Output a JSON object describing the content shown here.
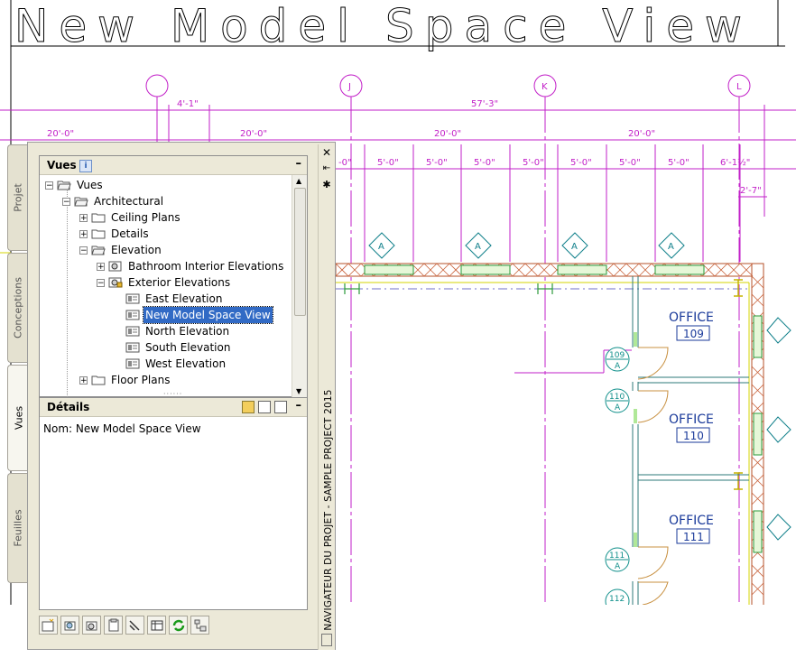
{
  "drawing": {
    "title": "New Model Space View",
    "grid_bubbles": [
      "J",
      "K",
      "L"
    ],
    "dimensions": {
      "row1": [
        "4'-1\"",
        "57'-3\""
      ],
      "row2": [
        "20'-0\"",
        "20'-0\"",
        "20'-0\"",
        "20'-0\""
      ],
      "row3": [
        "-0\"",
        "5'-0\"",
        "5'-0\"",
        "5'-0\"",
        "5'-0\"",
        "5'-0\"",
        "5'-0\"",
        "5'-0\"",
        "6'-1½\""
      ],
      "right": "2'-7\""
    },
    "window_tag": "A",
    "rooms": [
      {
        "name": "OFFICE",
        "number": "109"
      },
      {
        "name": "OFFICE",
        "number": "110"
      },
      {
        "name": "OFFICE",
        "number": "111"
      }
    ],
    "door_tags": [
      {
        "number": "109",
        "type": "A"
      },
      {
        "number": "110",
        "type": "A"
      },
      {
        "number": "111",
        "type": "A"
      },
      {
        "number": "112",
        "type": ""
      }
    ]
  },
  "navigator": {
    "side_tabs": [
      "Projet",
      "Conceptions",
      "Vues",
      "Feuilles"
    ],
    "active_tab": "Vues",
    "title": "NAVIGATEUR DU PROJET - SAMPLE PROJECT 2015",
    "views_section": {
      "title": "Vues",
      "tree": [
        {
          "label": "Vues",
          "level": 0,
          "icon": "folder-open",
          "expander": "-"
        },
        {
          "label": "Architectural",
          "level": 1,
          "icon": "folder-open",
          "expander": "-"
        },
        {
          "label": "Ceiling Plans",
          "level": 2,
          "icon": "folder",
          "expander": "+"
        },
        {
          "label": "Details",
          "level": 2,
          "icon": "folder",
          "expander": "+"
        },
        {
          "label": "Elevation",
          "level": 2,
          "icon": "folder-open",
          "expander": "-"
        },
        {
          "label": "Bathroom Interior Elevations",
          "level": 3,
          "icon": "view-set",
          "expander": "+"
        },
        {
          "label": "Exterior Elevations",
          "level": 3,
          "icon": "view-set-locked",
          "expander": "-"
        },
        {
          "label": "East Elevation",
          "level": 4,
          "icon": "view"
        },
        {
          "label": "New Model Space View",
          "level": 4,
          "icon": "view",
          "selected": true
        },
        {
          "label": "North Elevation",
          "level": 4,
          "icon": "view"
        },
        {
          "label": "South Elevation",
          "level": 4,
          "icon": "view"
        },
        {
          "label": "West Elevation",
          "level": 4,
          "icon": "view"
        },
        {
          "label": "Floor Plans",
          "level": 2,
          "icon": "folder",
          "expander": "+"
        }
      ]
    },
    "details_section": {
      "title": "Détails",
      "name_line": "Nom: New Model Space View"
    }
  }
}
